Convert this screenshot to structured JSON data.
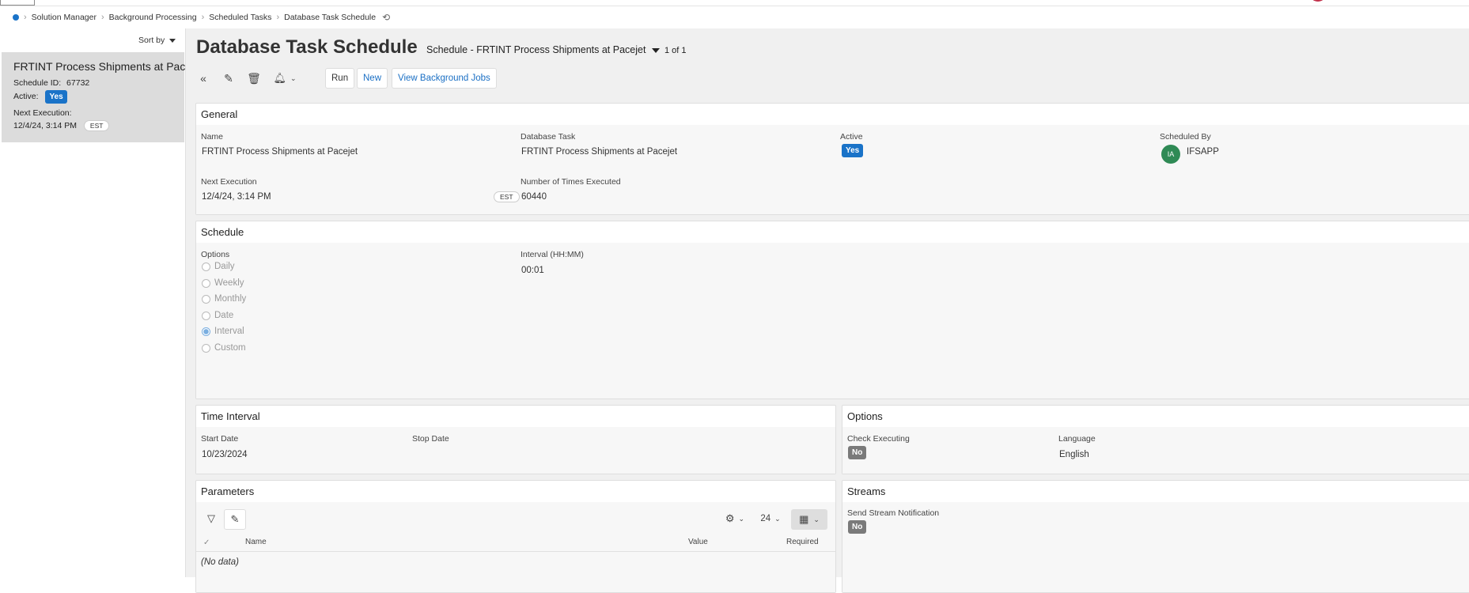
{
  "breadcrumb": {
    "items": [
      "Solution Manager",
      "Background Processing",
      "Scheduled Tasks",
      "Database Task Schedule"
    ]
  },
  "sidebar": {
    "sort_label": "Sort by",
    "card": {
      "title": "FRTINT Process Shipments at Pacejet",
      "schedule_id_label": "Schedule ID:",
      "schedule_id": "67732",
      "active_label": "Active:",
      "active_value": "Yes",
      "next_exec_label": "Next Execution:",
      "next_exec_value": "12/4/24, 3:14 PM",
      "timezone": "EST"
    }
  },
  "header": {
    "title": "Database Task Schedule",
    "record": "Schedule - FRTINT Process Shipments at Pacejet",
    "count": "1 of 1"
  },
  "toolbar": {
    "run_label": "Run",
    "new_label": "New",
    "view_jobs_label": "View Background Jobs",
    "icons": [
      "double-chevron-left-icon",
      "pencil-icon",
      "trash-icon",
      "bell-icon"
    ]
  },
  "general": {
    "title": "General",
    "name_label": "Name",
    "name_value": "FRTINT Process Shipments at Pacejet",
    "task_label": "Database Task",
    "task_value": "FRTINT Process Shipments at Pacejet",
    "active_label": "Active",
    "active_value": "Yes",
    "scheduled_by_label": "Scheduled By",
    "scheduled_by_initials": "IA",
    "scheduled_by_value": "IFSAPP",
    "next_exec_label": "Next Execution",
    "next_exec_value": "12/4/24, 3:14 PM",
    "timezone": "EST",
    "times_label": "Number of Times Executed",
    "times_value": "60440"
  },
  "schedule": {
    "title": "Schedule",
    "options_label": "Options",
    "options": [
      "Daily",
      "Weekly",
      "Monthly",
      "Date",
      "Interval",
      "Custom"
    ],
    "selected_option": "Interval",
    "interval_label": "Interval (HH:MM)",
    "interval_value": "00:01"
  },
  "time_interval": {
    "title": "Time Interval",
    "start_label": "Start Date",
    "start_value": "10/23/2024",
    "stop_label": "Stop Date"
  },
  "options_panel": {
    "title": "Options",
    "check_label": "Check Executing",
    "check_value": "No",
    "language_label": "Language",
    "language_value": "English"
  },
  "parameters": {
    "title": "Parameters",
    "page_size": "24",
    "columns": [
      "Name",
      "Value",
      "Required"
    ],
    "empty_text": "(No data)"
  },
  "streams": {
    "title": "Streams",
    "send_label": "Send Stream Notification",
    "send_value": "No"
  },
  "colors": {
    "accent": "#1a73c8",
    "badge_no": "#7a7a7a",
    "avatar": "#2f8a55",
    "main_bg": "#f0f0f0"
  }
}
